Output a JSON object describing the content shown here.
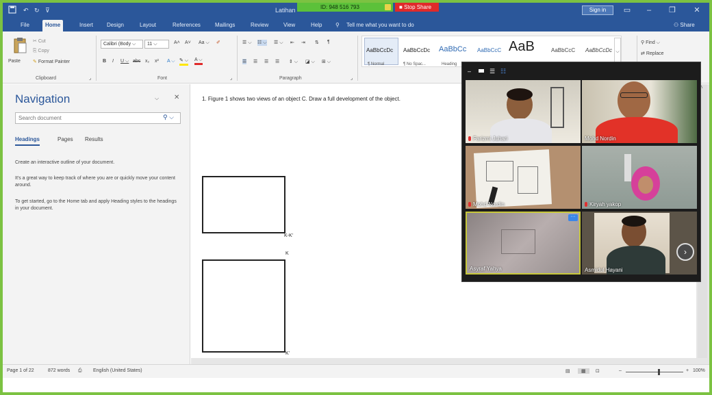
{
  "titlebar": {
    "save_icon": "save-icon",
    "undo_icon": "undo-icon",
    "redo_icon": "redo-icon",
    "doc_title": "Latihan",
    "meeting_id": "ID: 948 516 793",
    "stop_share": "Stop Share",
    "sign_in": "Sign in",
    "share_color": "#5cc13a",
    "stop_color": "#e02a2a"
  },
  "tabs": [
    {
      "label": "File"
    },
    {
      "label": "Home"
    },
    {
      "label": "Insert"
    },
    {
      "label": "Design"
    },
    {
      "label": "Layout"
    },
    {
      "label": "References"
    },
    {
      "label": "Mailings"
    },
    {
      "label": "Review"
    },
    {
      "label": "View"
    },
    {
      "label": "Help"
    }
  ],
  "tell_me": "Tell me what you want to do",
  "share_label": "Share",
  "ribbon": {
    "clipboard": {
      "paste": "Paste",
      "cut": "Cut",
      "copy": "Copy",
      "format_painter": "Format Painter",
      "label": "Clipboard"
    },
    "font": {
      "name": "Calibri (Body",
      "size": "11",
      "label": "Font"
    },
    "paragraph": {
      "label": "Paragraph"
    },
    "styles": [
      {
        "sample": "AaBbCcDc",
        "name": "¶ Normal"
      },
      {
        "sample": "AaBbCcDc",
        "name": "¶ No Spac..."
      },
      {
        "sample": "AaBbCc",
        "name": "Heading"
      },
      {
        "sample": "AaBbCcC",
        "name": ""
      },
      {
        "sample": "AaB",
        "name": ""
      },
      {
        "sample": "AaBbCcC",
        "name": ""
      },
      {
        "sample": "AaBbCcDc",
        "name": ""
      }
    ],
    "editing": {
      "find": "Find",
      "replace": "Replace"
    }
  },
  "navigation": {
    "title": "Navigation",
    "search_placeholder": "Search document",
    "tabs": [
      "Headings",
      "Pages",
      "Results"
    ],
    "para1": "Create an interactive outline of your document.",
    "para2": "It's a great way to keep track of where you are or quickly move your content around.",
    "para3": "To get started, go to the Home tab and apply Heading styles to the headings in your document."
  },
  "document": {
    "line1": "1.   Figure 1 shows two views of an object C. Draw a full development of the object.",
    "label_kk": "K-K'",
    "label_k": "K",
    "label_k2": "K'"
  },
  "status": {
    "page": "Page 1 of 22",
    "words": "872 words",
    "language": "English (United States)",
    "zoom": "100%"
  },
  "zoom_meeting": {
    "participants": [
      {
        "name": "Farizmi Juhari",
        "muted": true
      },
      {
        "name": "Mohd Nordin",
        "muted": false
      },
      {
        "name": "Mohd Nordin",
        "muted": true
      },
      {
        "name": "Kiryah yakop",
        "muted": true
      },
      {
        "name": "Asyraf Yahya",
        "muted": false
      },
      {
        "name": "Asmidul Hayani",
        "muted": false
      }
    ],
    "active_border": "#c8c83a"
  }
}
